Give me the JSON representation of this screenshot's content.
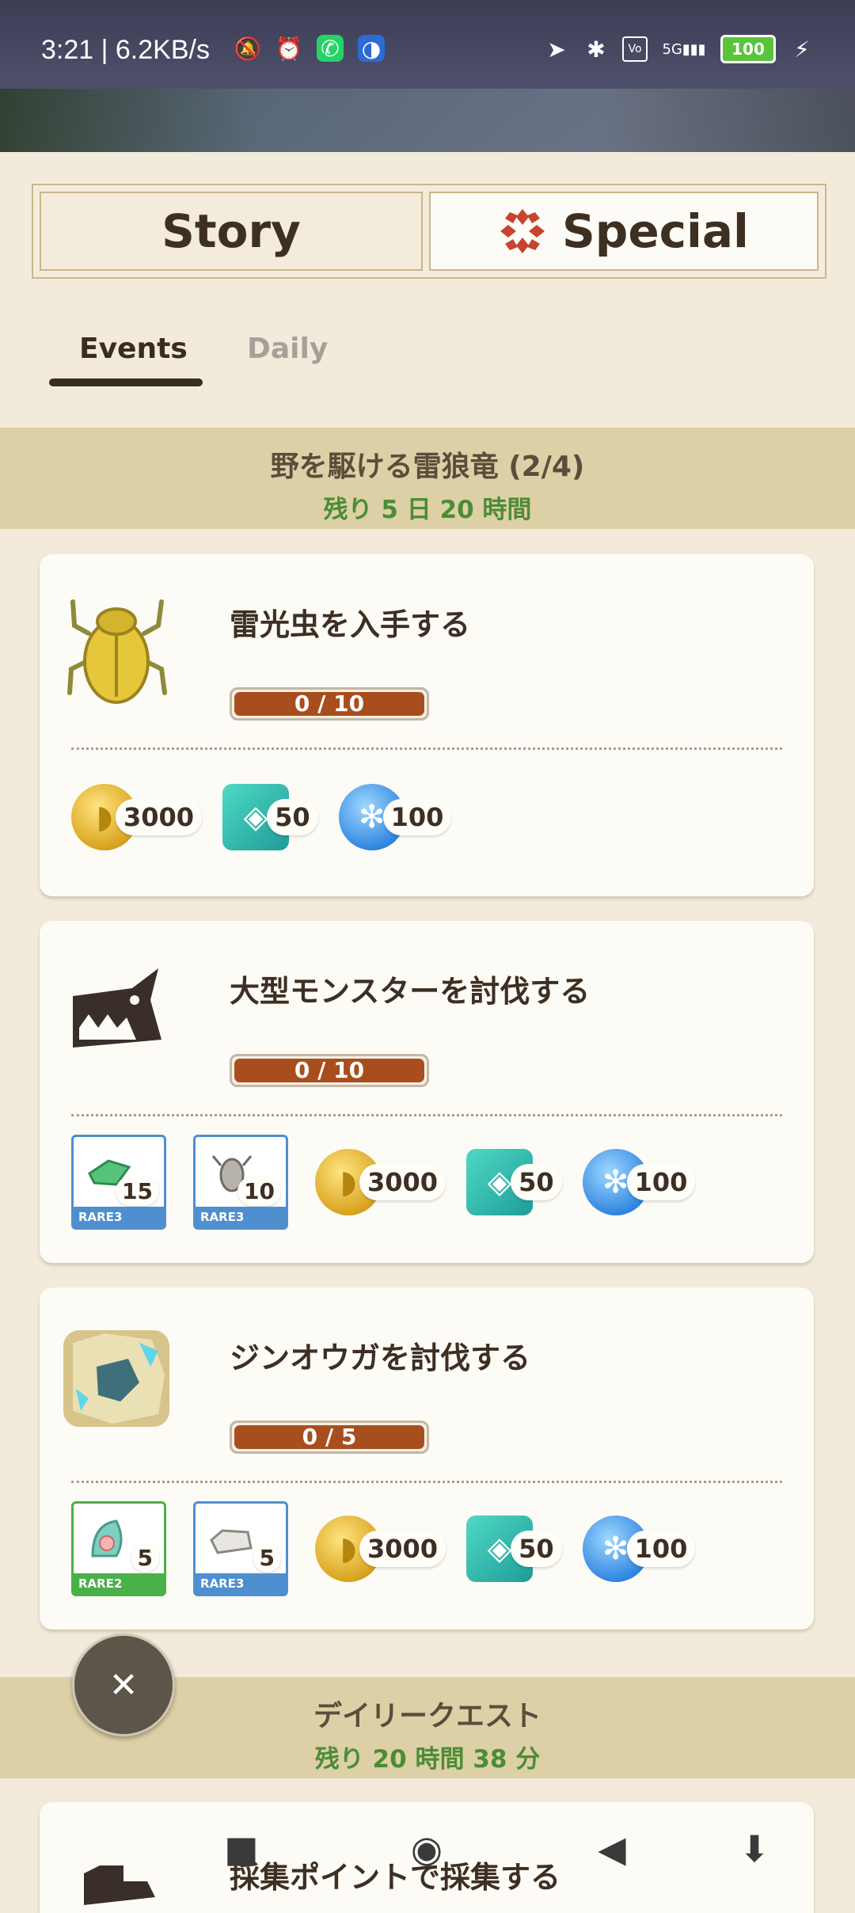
{
  "status_bar": {
    "time": "3:21 | 6.2KB/s",
    "battery": "100",
    "network": "5G"
  },
  "main_tabs": {
    "story": "Story",
    "special": "Special"
  },
  "sub_tabs": {
    "events": "Events",
    "daily": "Daily"
  },
  "event_section": {
    "title": "野を駆ける雷狼竜 (2/4)",
    "remaining": "残り 5 日 20 時間"
  },
  "quests": [
    {
      "title": "雷光虫を入手する",
      "progress_text": "0 / 10",
      "progress_fraction": 0,
      "icon": "thunderbug-icon",
      "items": [],
      "rewards": {
        "coins": "3000",
        "gems": "50",
        "orbs": "100"
      }
    },
    {
      "title": "大型モンスターを討伐する",
      "progress_text": "0 / 10",
      "progress_fraction": 0,
      "icon": "large-monster-icon",
      "items": [
        {
          "qty": "15",
          "rarity": "RARE3"
        },
        {
          "qty": "10",
          "rarity": "RARE3"
        }
      ],
      "rewards": {
        "coins": "3000",
        "gems": "50",
        "orbs": "100"
      }
    },
    {
      "title": "ジンオウガを討伐する",
      "progress_text": "0 / 5",
      "progress_fraction": 0,
      "icon": "zinogre-icon",
      "items": [
        {
          "qty": "5",
          "rarity": "RARE2"
        },
        {
          "qty": "5",
          "rarity": "RARE3"
        }
      ],
      "rewards": {
        "coins": "3000",
        "gems": "50",
        "orbs": "100"
      }
    }
  ],
  "daily_section": {
    "title": "デイリークエスト",
    "remaining": "残り 20 時間 38 分"
  },
  "daily_quest_preview": {
    "title": "採集ポイントで採集する"
  },
  "colors": {
    "accent_green": "#4c8c36",
    "progress_brown": "#a84e1e",
    "header_tan": "#ddd0a6"
  }
}
